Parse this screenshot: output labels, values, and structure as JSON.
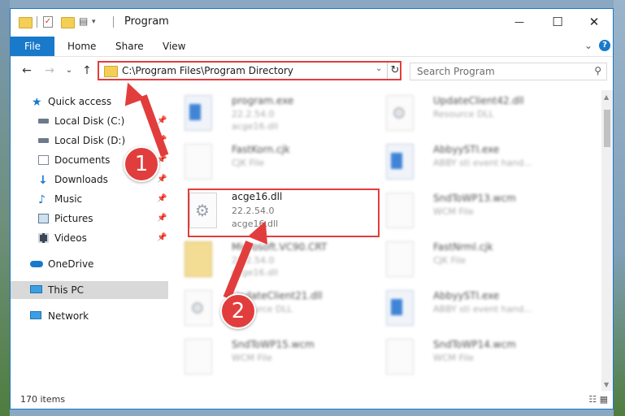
{
  "window": {
    "title": "Program",
    "minimize_glyph": "—",
    "maximize_glyph": "☐",
    "close_glyph": "✕"
  },
  "ribbon": {
    "tabs": [
      "File",
      "Home",
      "Share",
      "View"
    ],
    "expand_glyph": "⌄",
    "help_glyph": "?"
  },
  "address": {
    "back_glyph": "←",
    "forward_glyph": "→",
    "recent_glyph": "⌄",
    "up_glyph": "↑",
    "path": "C:\\Program Files\\Program Directory",
    "dropdown_glyph": "⌄",
    "refresh_glyph": "↻",
    "search_placeholder": "Search Program",
    "search_glyph": "⚲"
  },
  "sidebar": {
    "pin_glyph": "📌",
    "items": [
      {
        "label": "Quick access",
        "icon": "star-icon"
      },
      {
        "label": "Local Disk (C:)",
        "icon": "drive-icon",
        "pinned": true
      },
      {
        "label": "Local Disk (D:)",
        "icon": "drive-icon",
        "pinned": true
      },
      {
        "label": "Documents",
        "icon": "documents-icon",
        "pinned": true
      },
      {
        "label": "Downloads",
        "icon": "download-icon",
        "pinned": true
      },
      {
        "label": "Music",
        "icon": "music-icon",
        "pinned": true
      },
      {
        "label": "Pictures",
        "icon": "pictures-icon",
        "pinned": true
      },
      {
        "label": "Videos",
        "icon": "videos-icon",
        "pinned": true
      },
      {
        "label": "OneDrive",
        "icon": "cloud-icon"
      },
      {
        "label": "This PC",
        "icon": "computer-icon",
        "selected": true
      },
      {
        "label": "Network",
        "icon": "network-icon"
      }
    ]
  },
  "files": [
    {
      "name": "program.exe",
      "line2": "22.2.54.0",
      "line3": "acge16.dll",
      "icon": "application-icon"
    },
    {
      "name": "UpdateClient42.dll",
      "line2": "Resource DLL",
      "line3": "",
      "icon": "dll-icon"
    },
    {
      "name": "FastKorn.cjk",
      "line2": "CJK File",
      "line3": "",
      "icon": "file-icon"
    },
    {
      "name": "AbbyySTI.exe",
      "line2": "ABBY sti event hand...",
      "line3": "",
      "icon": "application-icon"
    },
    {
      "name": "acge16.dll",
      "line2": "22.2.54.0",
      "line3": "acge16.dll",
      "icon": "dll-icon",
      "highlighted": true
    },
    {
      "name": "SndToWP13.wcm",
      "line2": "WCM File",
      "line3": "",
      "icon": "file-icon"
    },
    {
      "name": "Microsoft.VC90.CRT",
      "line2": "22.2.54.0",
      "line3": "acge16.dll",
      "icon": "folder-icon"
    },
    {
      "name": "FastNrml.cjk",
      "line2": "CJK File",
      "line3": "",
      "icon": "file-icon"
    },
    {
      "name": "UpdateClient21.dll",
      "line2": "Resource DLL",
      "line3": "",
      "icon": "dll-icon"
    },
    {
      "name": "AbbyySTI.exe",
      "line2": "ABBY sti event hand...",
      "line3": "",
      "icon": "application-icon"
    },
    {
      "name": "SndToWP15.wcm",
      "line2": "WCM File",
      "line3": "",
      "icon": "file-icon"
    },
    {
      "name": "SndToWP14.wcm",
      "line2": "WCM File",
      "line3": "",
      "icon": "file-icon"
    }
  ],
  "status": {
    "item_count": "170 items",
    "view_glyphs": "☷ ▦"
  },
  "annotations": {
    "step1": "1",
    "step2": "2",
    "accent": "#e23d3d"
  }
}
